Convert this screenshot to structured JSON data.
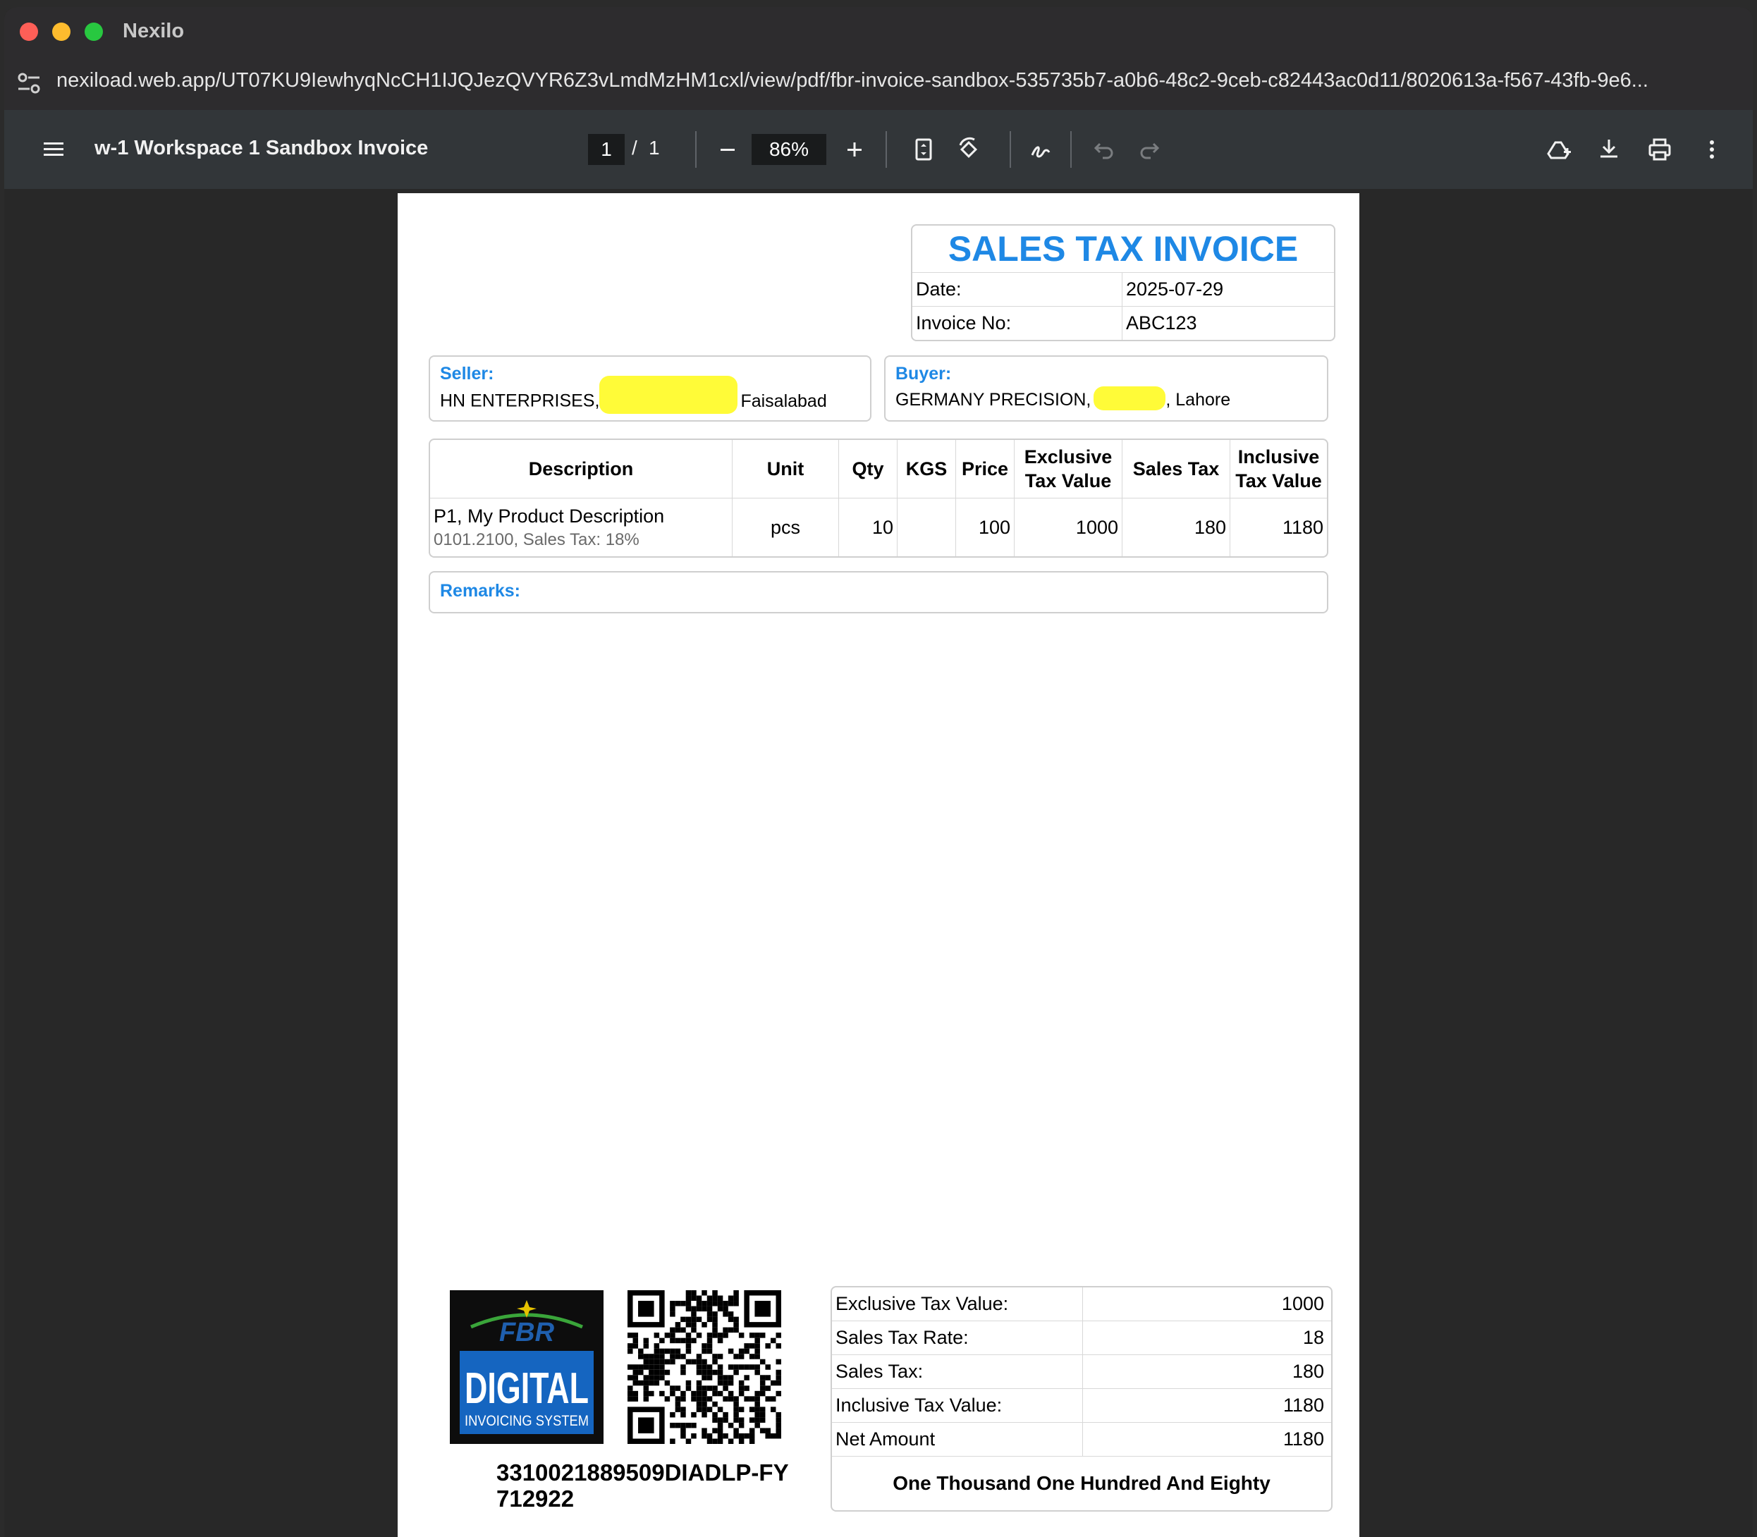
{
  "window": {
    "title": "Nexilo"
  },
  "address_bar": {
    "url": "nexiload.web.app/UT07KU9IewhyqNcCH1IJQJezQVYR6Z3vLmdMzHM1cxl/view/pdf/fbr-invoice-sandbox-535735b7-a0b6-48c2-9ceb-c82443ac0d11/8020613a-f567-43fb-9e6..."
  },
  "pdf_toolbar": {
    "document_title": "w-1 Workspace 1 Sandbox Invoice",
    "current_page": "1",
    "page_separator": "/",
    "total_pages": "1",
    "zoom": "86%",
    "icons": [
      "menu-icon",
      "zoom-out-icon",
      "zoom-in-icon",
      "fit-page-icon",
      "rotate-icon",
      "annotate-icon",
      "undo-icon",
      "redo-icon",
      "save-to-drive-icon",
      "download-icon",
      "print-icon",
      "more-icon"
    ]
  },
  "invoice": {
    "title": "SALES TAX INVOICE",
    "date_label": "Date:",
    "date_value": "2025-07-29",
    "invoice_no_label": "Invoice No:",
    "invoice_no_value": "ABC123",
    "seller": {
      "label": "Seller:",
      "name": "HN ENTERPRISES,",
      "city": "Faisalabad"
    },
    "buyer": {
      "label": "Buyer:",
      "name": "GERMANY PRECISION,",
      "city": ", Lahore"
    },
    "columns": [
      "Description",
      "Unit",
      "Qty",
      "KGS",
      "Price",
      "Exclusive Tax Value",
      "Sales Tax",
      "Inclusive Tax Value"
    ],
    "items": [
      {
        "description": "P1, My Product Description",
        "sub": "0101.2100, Sales Tax: 18%",
        "unit": "pcs",
        "qty": "10",
        "kgs": "",
        "price": "100",
        "exclusive": "1000",
        "sales_tax": "180",
        "inclusive": "1180"
      }
    ],
    "remarks_label": "Remarks:",
    "logo": {
      "top": "FBR",
      "main": "DIGITAL",
      "sub": "INVOICING SYSTEM"
    },
    "irn": "3310021889509DIADLP-FY712922",
    "totals": [
      {
        "label": "Exclusive Tax Value:",
        "value": "1000"
      },
      {
        "label": "Sales Tax Rate:",
        "value": "18"
      },
      {
        "label": "Sales Tax:",
        "value": "180"
      },
      {
        "label": "Inclusive Tax Value:",
        "value": "1180"
      },
      {
        "label": "Net Amount",
        "value": "1180"
      }
    ],
    "amount_in_words": "One Thousand One Hundred And Eighty"
  },
  "colors": {
    "accent": "#1e88e5",
    "highlight": "#fffb38",
    "toolbar": "#323639"
  }
}
